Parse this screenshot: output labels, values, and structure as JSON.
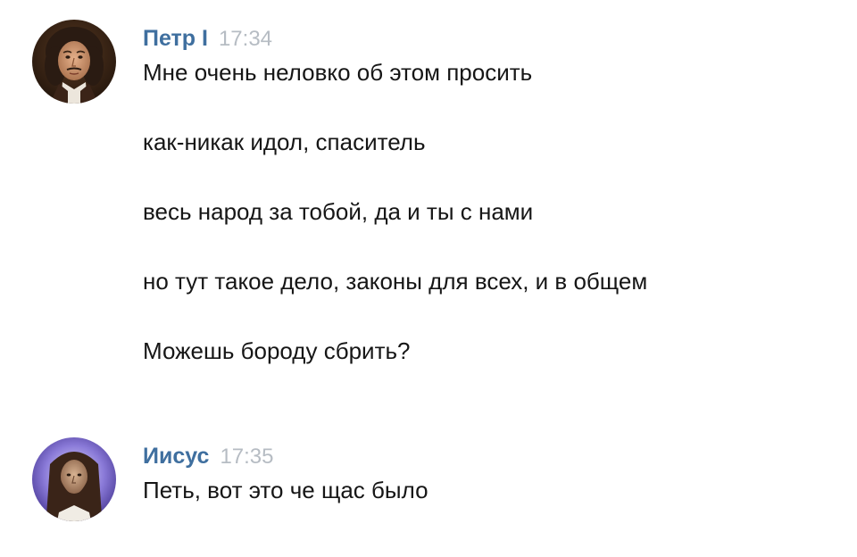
{
  "messages": [
    {
      "author": "Петр I",
      "time": "17:34",
      "avatar_icon": "peter-the-great-portrait",
      "lines": [
        "Мне очень неловко об этом просить",
        "как-никак идол, спаситель",
        "весь народ за тобой, да и ты с нами",
        "но тут такое дело, законы для всех, и в общем",
        "Можешь бороду сбрить?"
      ]
    },
    {
      "author": "Иисус",
      "time": "17:35",
      "avatar_icon": "jesus-portrait",
      "lines": [
        "Петь, вот это че щас было"
      ]
    }
  ],
  "colors": {
    "author_link": "#3f6f9f",
    "timestamp": "#b6bcc3",
    "text": "#161616",
    "background": "#ffffff"
  }
}
